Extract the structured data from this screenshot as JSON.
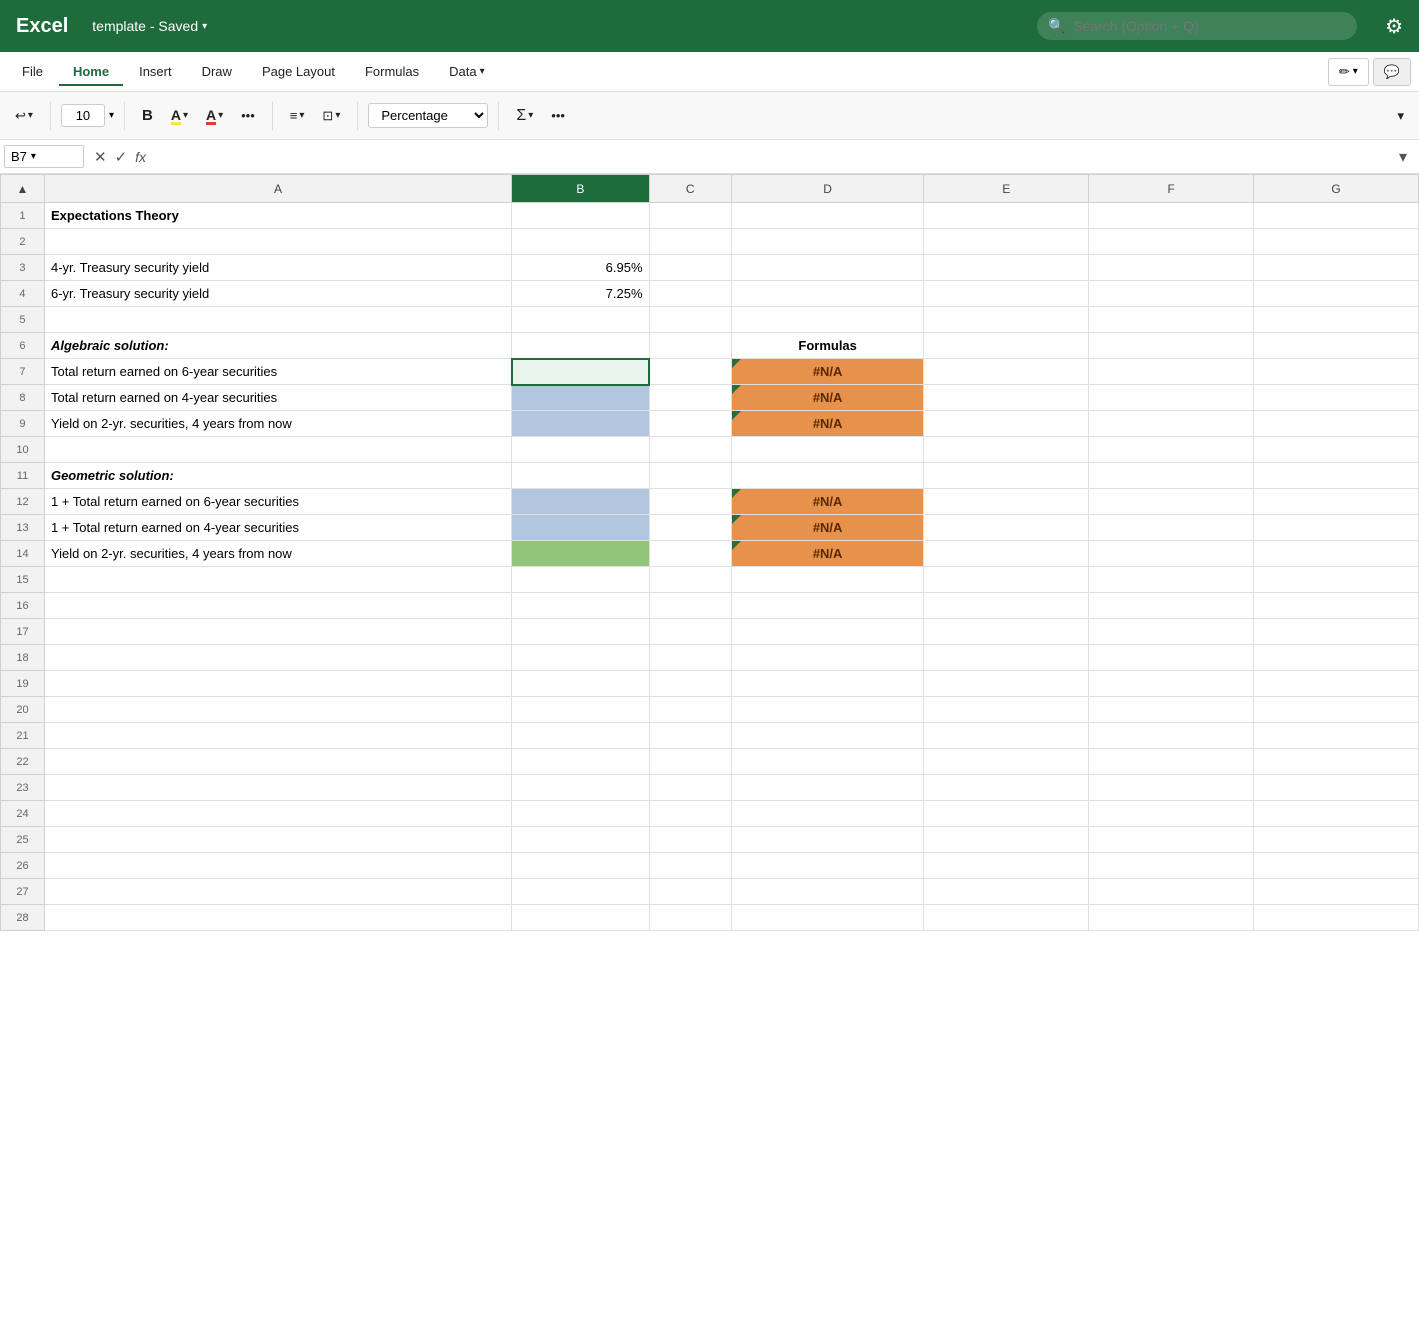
{
  "titleBar": {
    "appName": "Excel",
    "fileTitle": "template - Saved",
    "chevron": "▾",
    "searchPlaceholder": "Search (Option + Q)",
    "gearIcon": "⚙"
  },
  "menuBar": {
    "items": [
      {
        "label": "File",
        "active": false
      },
      {
        "label": "Home",
        "active": true
      },
      {
        "label": "Insert",
        "active": false
      },
      {
        "label": "Draw",
        "active": false
      },
      {
        "label": "Page Layout",
        "active": false
      },
      {
        "label": "Formulas",
        "active": false
      },
      {
        "label": "Data",
        "active": false
      }
    ],
    "dataChevron": "▾",
    "editIcon": "✏",
    "chatIcon": "💬"
  },
  "ribbon": {
    "undoLabel": "↩",
    "undoChevron": "▾",
    "fontSize": "10",
    "fontSizeChevron": "▾",
    "boldLabel": "B",
    "highlightLabel": "A",
    "fontColorLabel": "A",
    "moreBtn": "•••",
    "alignBtn": "≡",
    "alignChevron": "▾",
    "wrapBtn": "⊡",
    "wrapChevron": "▾",
    "formatLabel": "Percentage",
    "sumLabel": "Σ",
    "sumChevron": "▾",
    "moreBtn2": "•••",
    "expandChevron": "▾"
  },
  "formulaBar": {
    "cellRef": "B7",
    "cellRefChevron": "▾",
    "cancelIcon": "✕",
    "confirmIcon": "✓",
    "fxIcon": "fx",
    "formula": "",
    "expandIcon": "▾"
  },
  "columns": {
    "corner": "",
    "a": "A",
    "b": "B",
    "c": "C",
    "d": "D",
    "e": "E",
    "f": "F",
    "g": "G"
  },
  "rows": [
    {
      "num": "1",
      "a": "Expectations Theory",
      "b": "",
      "c": "",
      "d": "",
      "e": "",
      "f": "",
      "g": "",
      "a_bold": true
    },
    {
      "num": "2",
      "a": "",
      "b": "",
      "c": "",
      "d": "",
      "e": "",
      "f": "",
      "g": ""
    },
    {
      "num": "3",
      "a": "4-yr. Treasury security yield",
      "b": "6.95%",
      "c": "",
      "d": "",
      "e": "",
      "f": "",
      "g": "",
      "b_align": "right"
    },
    {
      "num": "4",
      "a": "6-yr. Treasury security yield",
      "b": "7.25%",
      "c": "",
      "d": "",
      "e": "",
      "f": "",
      "g": "",
      "b_align": "right"
    },
    {
      "num": "5",
      "a": "",
      "b": "",
      "c": "",
      "d": "",
      "e": "",
      "f": "",
      "g": ""
    },
    {
      "num": "6",
      "a": "Algebraic solution:",
      "b": "",
      "c": "",
      "d": "Formulas",
      "e": "",
      "f": "",
      "g": "",
      "a_italic": true,
      "d_bold": true,
      "d_align": "center"
    },
    {
      "num": "7",
      "a": "Total return earned on 6-year securities",
      "b": "",
      "c": "",
      "d": "#N/A",
      "e": "",
      "f": "",
      "g": "",
      "b_selected": true,
      "d_orange": true,
      "d_corner": true
    },
    {
      "num": "8",
      "a": "Total return earned on 4-year securities",
      "b": "",
      "c": "",
      "d": "#N/A",
      "e": "",
      "f": "",
      "g": "",
      "b_blue": true,
      "d_orange": true,
      "d_corner": true
    },
    {
      "num": "9",
      "a": "Yield on 2-yr. securities, 4 years from now",
      "b": "",
      "c": "",
      "d": "#N/A",
      "e": "",
      "f": "",
      "g": "",
      "b_blue": true,
      "d_orange": true,
      "d_corner": true
    },
    {
      "num": "10",
      "a": "",
      "b": "",
      "c": "",
      "d": "",
      "e": "",
      "f": "",
      "g": ""
    },
    {
      "num": "11",
      "a": "Geometric solution:",
      "b": "",
      "c": "",
      "d": "",
      "e": "",
      "f": "",
      "g": "",
      "a_italic": true
    },
    {
      "num": "12",
      "a": "1 + Total return earned on 6-year securities",
      "b": "",
      "c": "",
      "d": "#N/A",
      "e": "",
      "f": "",
      "g": "",
      "b_blue": true,
      "d_orange": true,
      "d_corner": true
    },
    {
      "num": "13",
      "a": "1 + Total return earned on 4-year securities",
      "b": "",
      "c": "",
      "d": "#N/A",
      "e": "",
      "f": "",
      "g": "",
      "b_blue": true,
      "d_orange": true,
      "d_corner": true
    },
    {
      "num": "14",
      "a": "Yield on 2-yr. securities, 4 years from now",
      "b": "",
      "c": "",
      "d": "#N/A",
      "e": "",
      "f": "",
      "g": "",
      "b_green": true,
      "d_orange": true,
      "d_corner": true
    },
    {
      "num": "15",
      "a": "",
      "b": "",
      "c": "",
      "d": "",
      "e": "",
      "f": "",
      "g": ""
    },
    {
      "num": "16",
      "a": "",
      "b": "",
      "c": "",
      "d": "",
      "e": "",
      "f": "",
      "g": ""
    },
    {
      "num": "17",
      "a": "",
      "b": "",
      "c": "",
      "d": "",
      "e": "",
      "f": "",
      "g": ""
    },
    {
      "num": "18",
      "a": "",
      "b": "",
      "c": "",
      "d": "",
      "e": "",
      "f": "",
      "g": ""
    },
    {
      "num": "19",
      "a": "",
      "b": "",
      "c": "",
      "d": "",
      "e": "",
      "f": "",
      "g": ""
    },
    {
      "num": "20",
      "a": "",
      "b": "",
      "c": "",
      "d": "",
      "e": "",
      "f": "",
      "g": ""
    },
    {
      "num": "21",
      "a": "",
      "b": "",
      "c": "",
      "d": "",
      "e": "",
      "f": "",
      "g": ""
    },
    {
      "num": "22",
      "a": "",
      "b": "",
      "c": "",
      "d": "",
      "e": "",
      "f": "",
      "g": ""
    },
    {
      "num": "23",
      "a": "",
      "b": "",
      "c": "",
      "d": "",
      "e": "",
      "f": "",
      "g": ""
    },
    {
      "num": "24",
      "a": "",
      "b": "",
      "c": "",
      "d": "",
      "e": "",
      "f": "",
      "g": ""
    },
    {
      "num": "25",
      "a": "",
      "b": "",
      "c": "",
      "d": "",
      "e": "",
      "f": "",
      "g": ""
    },
    {
      "num": "26",
      "a": "",
      "b": "",
      "c": "",
      "d": "",
      "e": "",
      "f": "",
      "g": ""
    },
    {
      "num": "27",
      "a": "",
      "b": "",
      "c": "",
      "d": "",
      "e": "",
      "f": "",
      "g": ""
    },
    {
      "num": "28",
      "a": "",
      "b": "",
      "c": "",
      "d": "",
      "e": "",
      "f": "",
      "g": ""
    }
  ]
}
